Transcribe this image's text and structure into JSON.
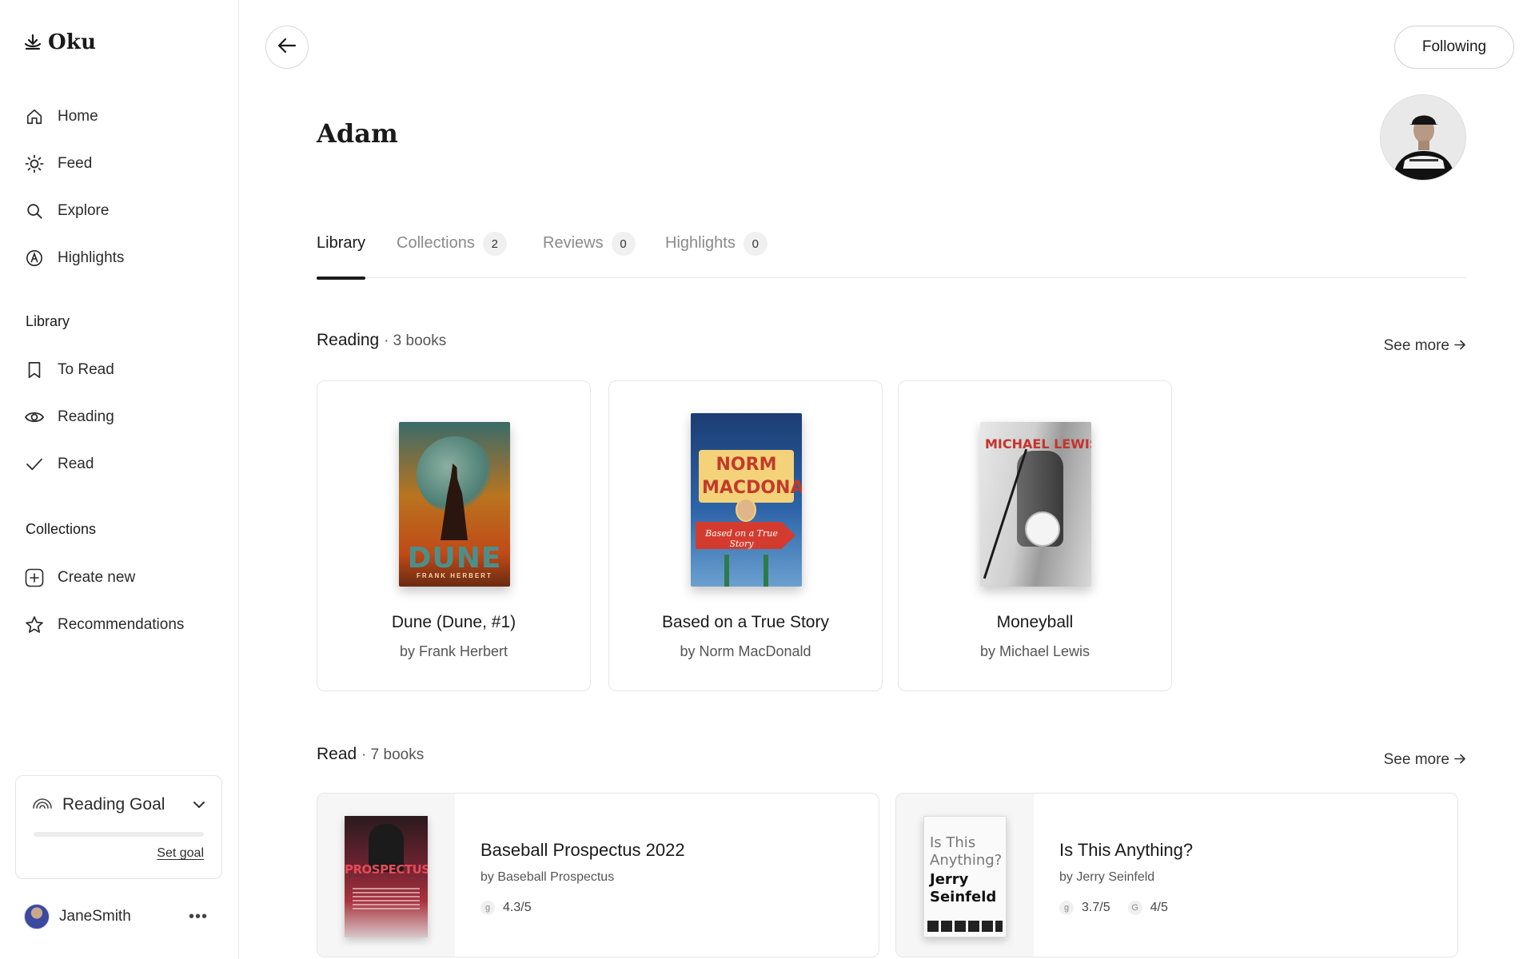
{
  "app": {
    "name": "Oku"
  },
  "sidebar": {
    "nav": [
      {
        "label": "Home",
        "icon": "home-icon"
      },
      {
        "label": "Feed",
        "icon": "sun-icon"
      },
      {
        "label": "Explore",
        "icon": "search-icon"
      },
      {
        "label": "Highlights",
        "icon": "highlight-icon"
      }
    ],
    "library_title": "Library",
    "library": [
      {
        "label": "To Read",
        "icon": "bookmark-icon"
      },
      {
        "label": "Reading",
        "icon": "eye-icon"
      },
      {
        "label": "Read",
        "icon": "check-icon"
      }
    ],
    "collections_title": "Collections",
    "collections": [
      {
        "label": "Create new",
        "icon": "plus-icon"
      },
      {
        "label": "Recommendations",
        "icon": "star-icon"
      }
    ],
    "goal": {
      "label": "Reading Goal",
      "link": "Set goal",
      "progress": 0
    },
    "user": {
      "name": "JaneSmith",
      "more": "•••"
    }
  },
  "header": {
    "follow_label": "Following"
  },
  "profile": {
    "name": "Adam"
  },
  "tabs": [
    {
      "label": "Library",
      "count": null,
      "active": true
    },
    {
      "label": "Collections",
      "count": "2",
      "active": false
    },
    {
      "label": "Reviews",
      "count": "0",
      "active": false
    },
    {
      "label": "Highlights",
      "count": "0",
      "active": false
    }
  ],
  "reading": {
    "title": "Reading",
    "count": "· 3 books",
    "see_more": "See more",
    "books": [
      {
        "title": "Dune (Dune, #1)",
        "author": "by Frank Herbert",
        "cover_title": "DUNE",
        "cover_author": "FRANK HERBERT"
      },
      {
        "title": "Based on a True Story",
        "author": "by Norm MacDonald",
        "cover_title": "NORM MACDONAL",
        "cover_sub": "Based on a True Story"
      },
      {
        "title": "Moneyball",
        "author": "by Michael Lewis",
        "cover_title": "MICHAEL LEWIS"
      }
    ]
  },
  "read": {
    "title": "Read",
    "count": "· 7 books",
    "see_more": "See more",
    "books": [
      {
        "title": "Baseball Prospectus 2022",
        "author": "by Baseball Prospectus",
        "cover_title": "PROSPECTUS",
        "ratings": [
          {
            "src": "g",
            "value": "4.3/5"
          }
        ]
      },
      {
        "title": "Is This Anything?",
        "author": "by Jerry Seinfeld",
        "cover_title": "Is This Anything?",
        "cover_author": "Jerry Seinfeld",
        "ratings": [
          {
            "src": "g",
            "value": "3.7/5"
          },
          {
            "src": "G",
            "value": "4/5"
          }
        ]
      }
    ]
  }
}
